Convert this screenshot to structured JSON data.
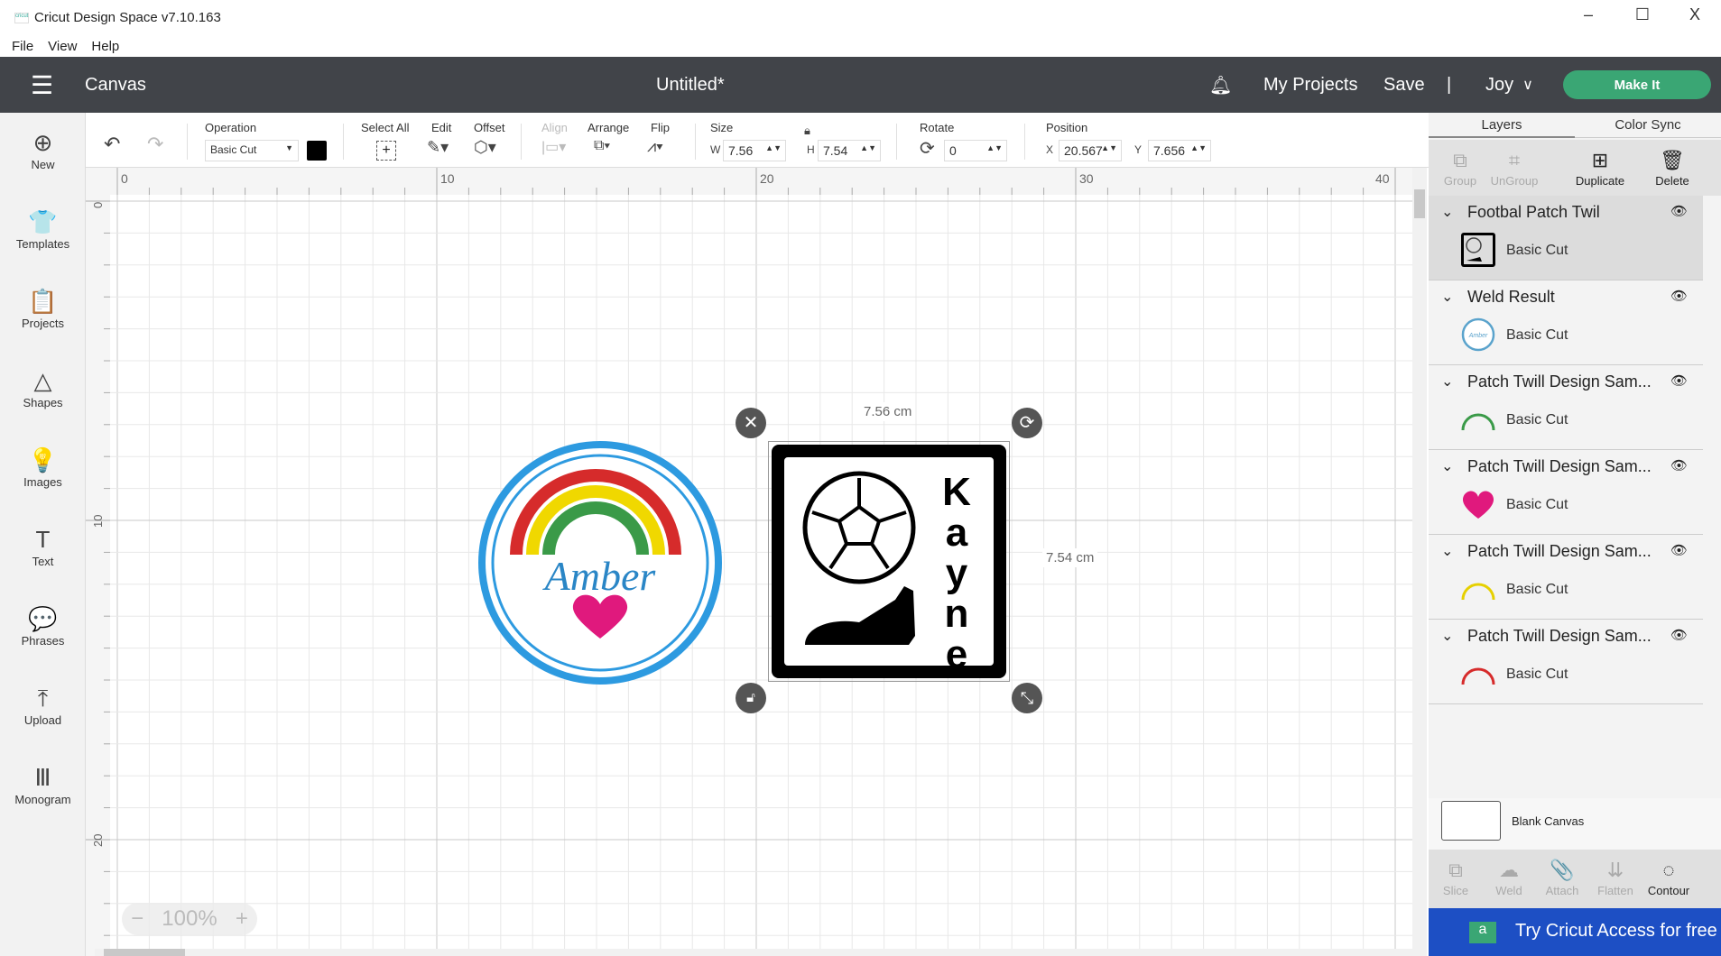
{
  "window": {
    "title": "Cricut Design Space  v7.10.163",
    "minimize": "–",
    "maximize": "☐",
    "close": "X"
  },
  "menu": [
    "File",
    "View",
    "Help"
  ],
  "header": {
    "section": "Canvas",
    "doc_title": "Untitled*",
    "my_projects": "My Projects",
    "save": "Save",
    "divider": "|",
    "user": "Joy",
    "make_it": "Make It"
  },
  "sidebar": [
    {
      "label": "New",
      "icon": "⊕"
    },
    {
      "label": "Templates",
      "icon": "👕"
    },
    {
      "label": "Projects",
      "icon": "📋"
    },
    {
      "label": "Shapes",
      "icon": "△"
    },
    {
      "label": "Images",
      "icon": "💡"
    },
    {
      "label": "Text",
      "icon": "T"
    },
    {
      "label": "Phrases",
      "icon": "💬"
    },
    {
      "label": "Upload",
      "icon": "⤒"
    },
    {
      "label": "Monogram",
      "icon": "Ⅲ"
    }
  ],
  "toolbar": {
    "operation_label": "Operation",
    "operation_value": "Basic Cut",
    "operation_color": "#000000",
    "select_all": "Select All",
    "edit": "Edit",
    "offset": "Offset",
    "align": "Align",
    "arrange": "Arrange",
    "flip": "Flip",
    "size": "Size",
    "w_label": "W",
    "w": "7.56",
    "h_label": "H",
    "h": "7.54",
    "rotate": "Rotate",
    "rotate_value": "0",
    "position": "Position",
    "x_label": "X",
    "x": "20.567",
    "y_label": "Y",
    "y": "7.656"
  },
  "rulers": {
    "top": [
      "0",
      "10",
      "20",
      "30",
      "40"
    ],
    "left": [
      "0",
      "10",
      "20"
    ]
  },
  "selection": {
    "width_label": "7.56 cm",
    "height_label": "7.54 cm"
  },
  "designs": {
    "amber_text": "Amber",
    "kayne_letters": [
      "K",
      "a",
      "y",
      "n",
      "e"
    ]
  },
  "zoom": {
    "value": "100%",
    "minus": "−",
    "plus": "+"
  },
  "panel": {
    "tabs": [
      "Layers",
      "Color Sync"
    ],
    "tools": [
      {
        "label": "Group",
        "enabled": false
      },
      {
        "label": "UnGroup",
        "enabled": false
      },
      {
        "label": "Duplicate",
        "enabled": true
      },
      {
        "label": "Delete",
        "enabled": true
      }
    ],
    "layers": [
      {
        "name": "Footbal Patch Twil",
        "op": "Basic Cut",
        "thumb": "patch",
        "selected": true
      },
      {
        "name": "Weld Result",
        "op": "Basic Cut",
        "thumb": "circle"
      },
      {
        "name": "Patch Twill Design Sam...",
        "op": "Basic Cut",
        "thumb": "arc",
        "color": "#3a9a48"
      },
      {
        "name": "Patch Twill Design Sam...",
        "op": "Basic Cut",
        "thumb": "heart",
        "color": "#e0197d"
      },
      {
        "name": "Patch Twill Design Sam...",
        "op": "Basic Cut",
        "thumb": "arc",
        "color": "#e6d000"
      },
      {
        "name": "Patch Twill Design Sam...",
        "op": "Basic Cut",
        "thumb": "arc",
        "color": "#d62b2b"
      }
    ],
    "blank_canvas": "Blank Canvas",
    "bottom_tools": [
      {
        "label": "Slice",
        "enabled": false
      },
      {
        "label": "Weld",
        "enabled": false
      },
      {
        "label": "Attach",
        "enabled": false
      },
      {
        "label": "Flatten",
        "enabled": false
      },
      {
        "label": "Contour",
        "enabled": true
      }
    ],
    "banner": "Try Cricut Access for free"
  },
  "colors": {
    "header": "#414449",
    "make_it": "#3aa674",
    "banner": "#1d4fc4",
    "circle": "#2d9ae0",
    "heart": "#e0197d"
  }
}
